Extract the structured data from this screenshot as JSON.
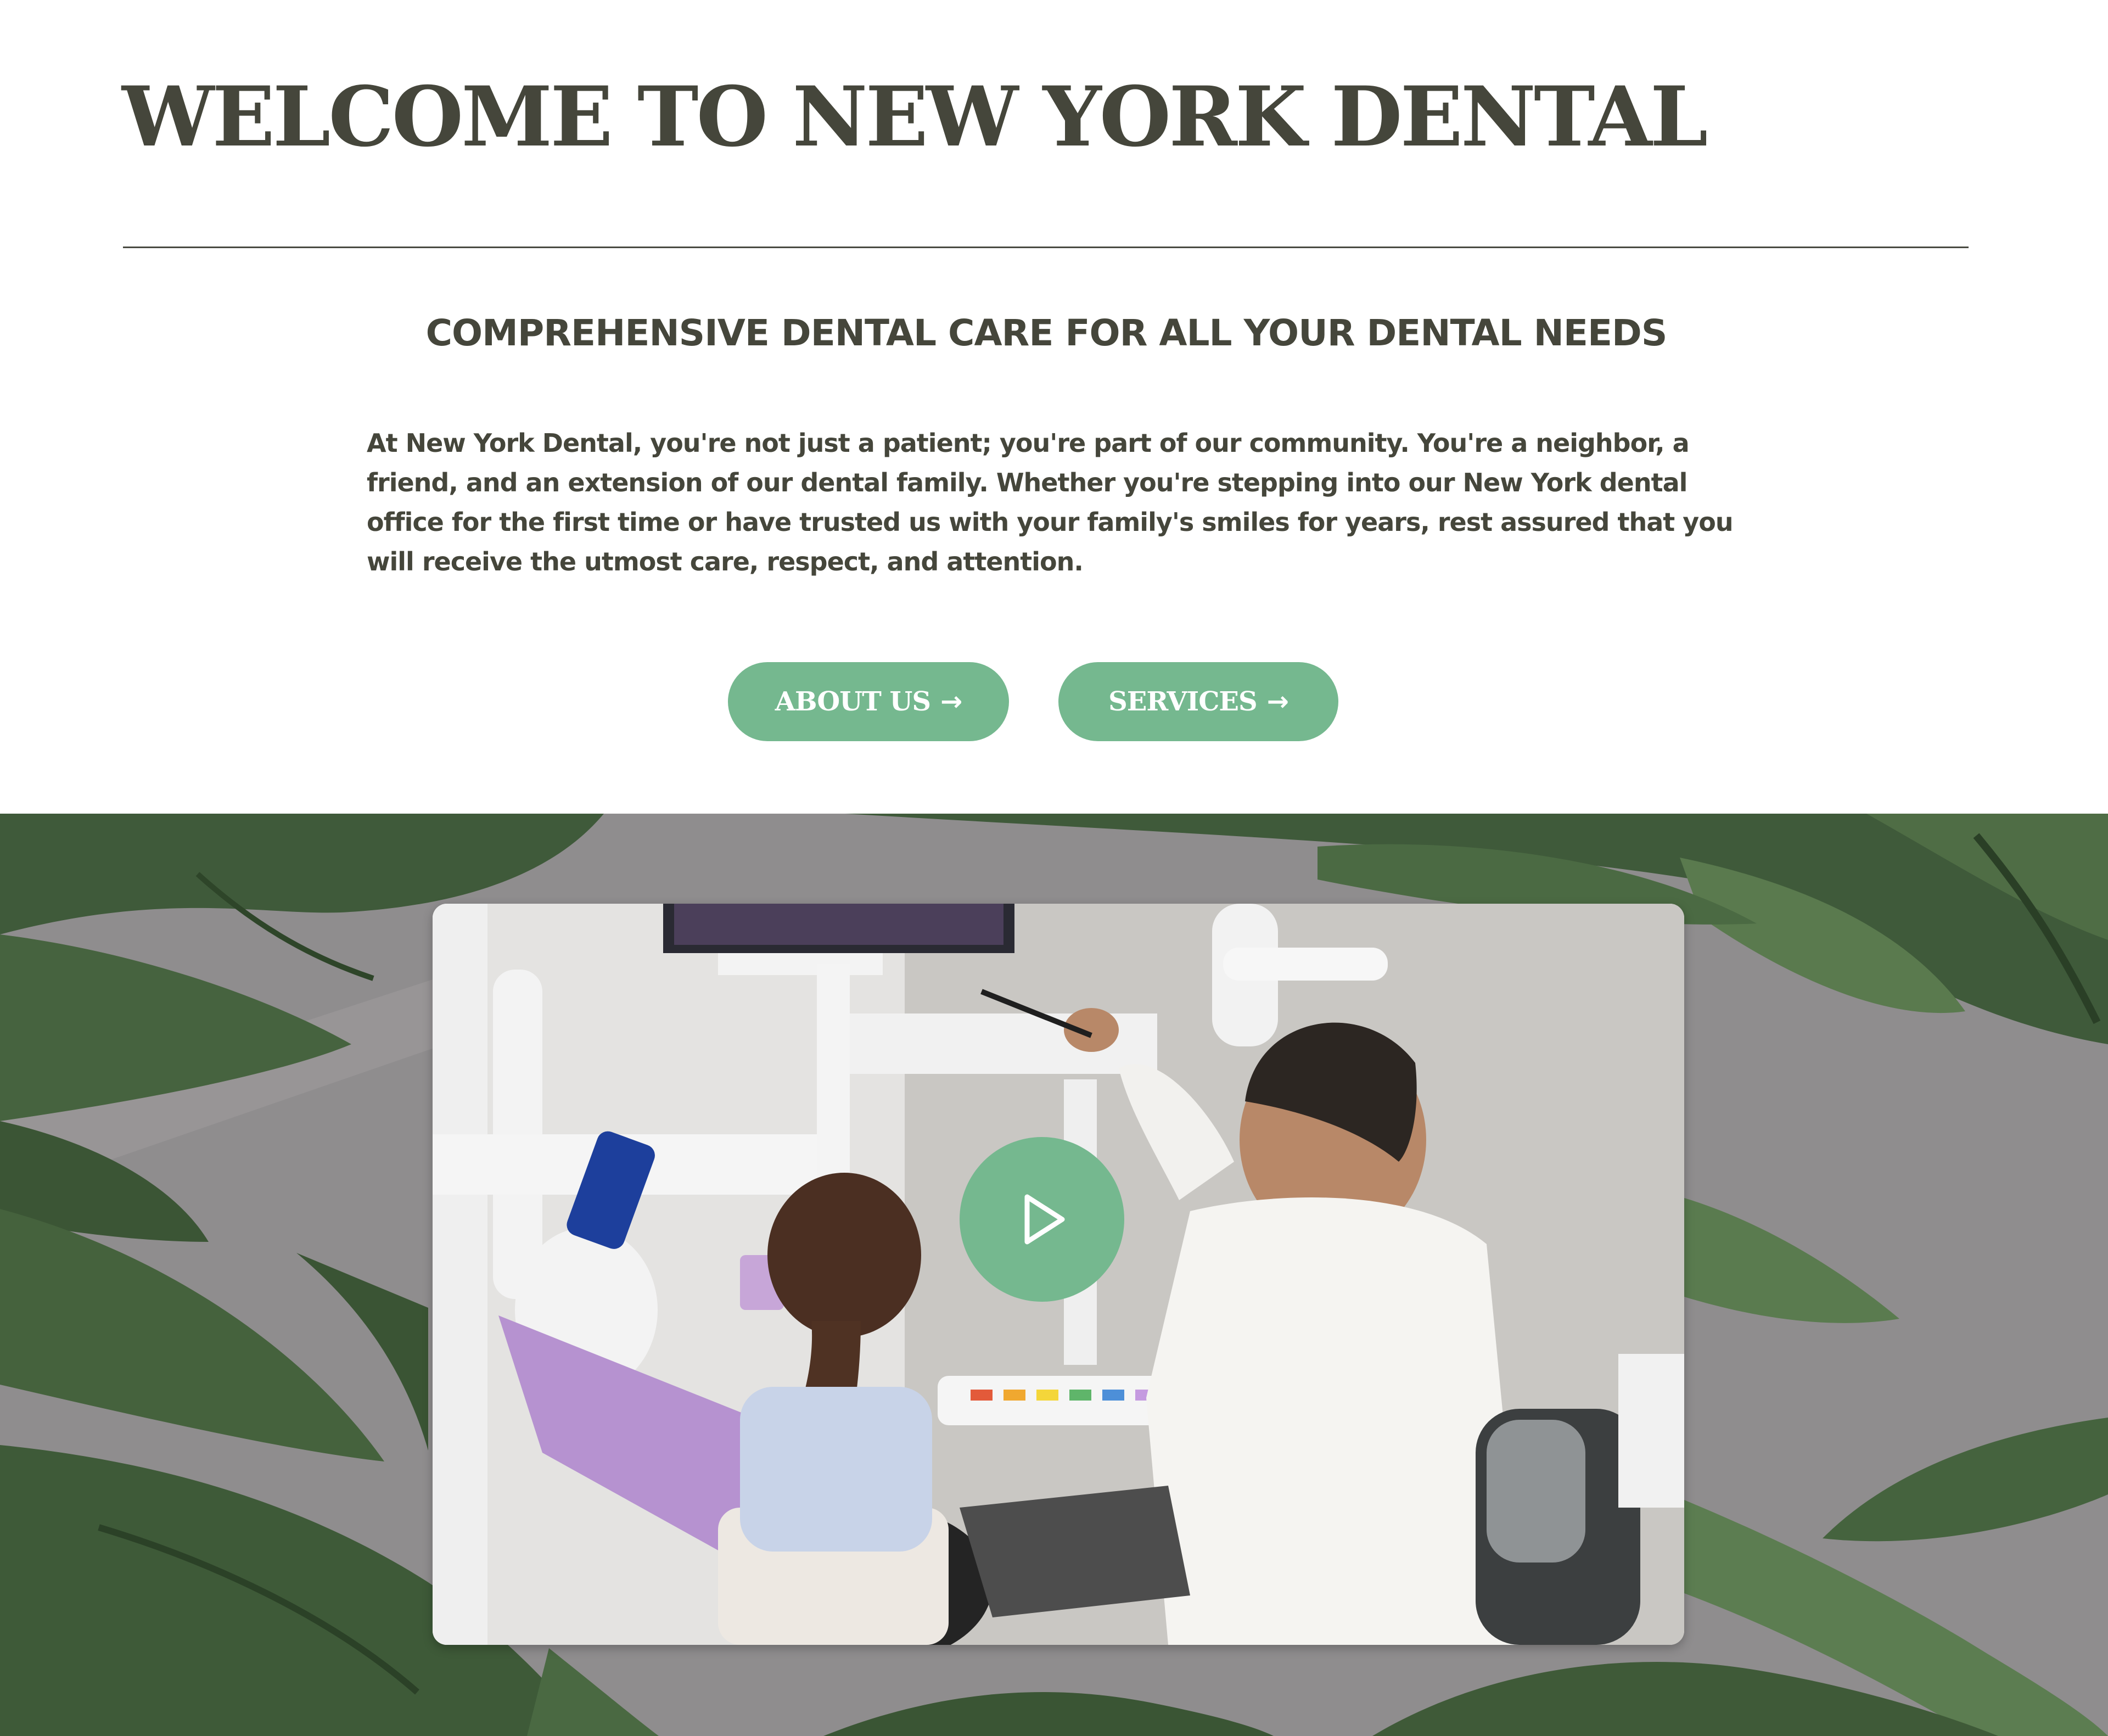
{
  "header": {
    "title": "WELCOME TO NEW YORK DENTAL"
  },
  "intro": {
    "subtitle": "COMPREHENSIVE DENTAL CARE FOR ALL YOUR DENTAL NEEDS",
    "paragraph": "At New York Dental, you're not just a patient; you're part of our community. You're a neighbor, a friend, and an extension of our dental family. Whether you're stepping into our New York dental office for the first time or have trusted us with your family's smiles for years, rest assured that you will receive the utmost care, respect, and attention."
  },
  "buttons": {
    "about_label": "ABOUT US",
    "services_label": "SERVICES",
    "arrow": "→"
  },
  "video": {
    "play_icon": "play-icon",
    "scene_description_icon": "dentist-with-patient-image"
  },
  "colors": {
    "accent_green": "#75b88f",
    "text_dark": "#45463b",
    "section_gray": "#8f8d8e",
    "leaf_green": "#3f5a3a"
  }
}
